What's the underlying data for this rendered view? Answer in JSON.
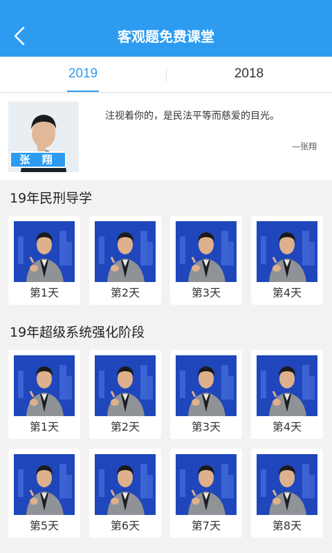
{
  "header": {
    "title": "客观题免费课堂",
    "back_icon": "back-arrow-icon"
  },
  "tabs": [
    {
      "label": "2019",
      "active": true
    },
    {
      "label": "2018",
      "active": false
    }
  ],
  "teacher": {
    "name": "张 翔",
    "quote": "注视着你的，是民法平等而慈爱的目光。",
    "author": "—张翔"
  },
  "sections": [
    {
      "title": "19年民刑导学",
      "items": [
        "第1天",
        "第2天",
        "第3天",
        "第4天"
      ]
    },
    {
      "title": "19年超级系统强化阶段",
      "items": [
        "第1天",
        "第2天",
        "第3天",
        "第4天",
        "第5天",
        "第6天",
        "第7天",
        "第8天"
      ]
    }
  ],
  "colors": {
    "accent": "#2d9cf0",
    "thumb_bg": "#1a3fb0",
    "background": "#f2f2f2"
  }
}
